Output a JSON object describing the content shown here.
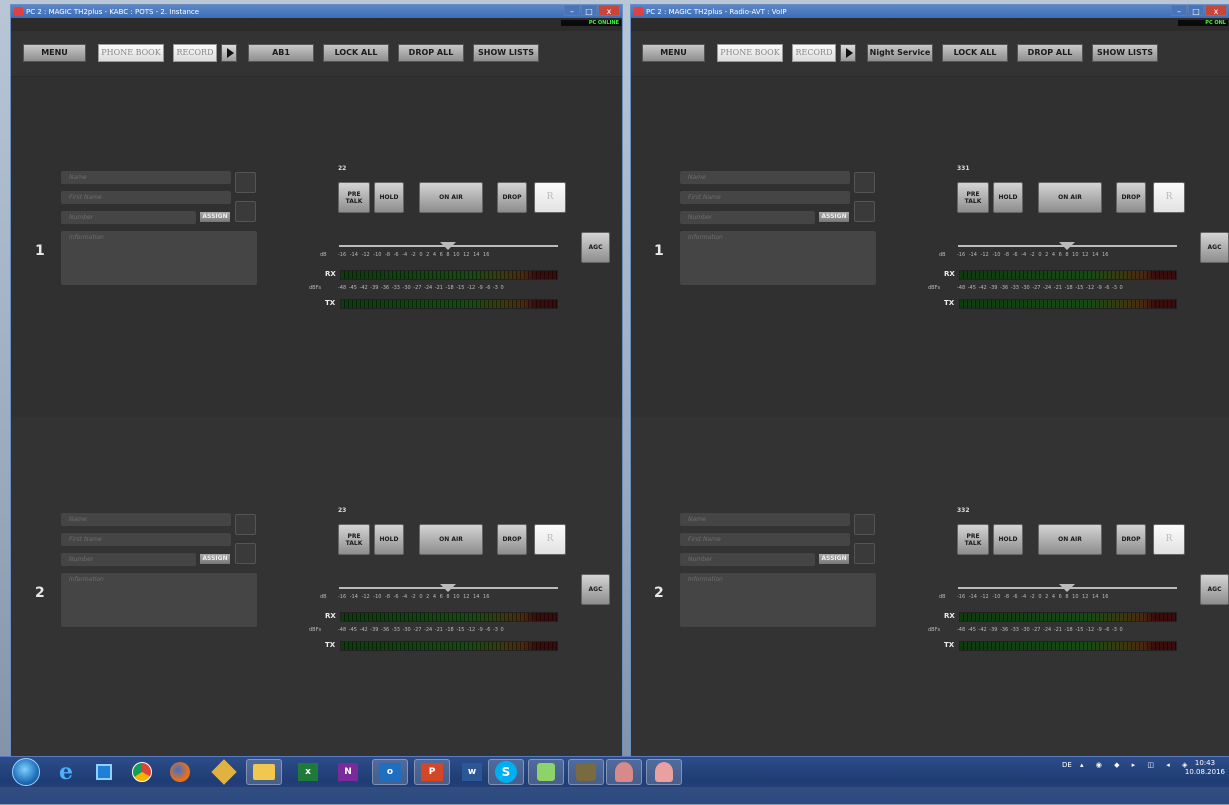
{
  "windows": [
    {
      "title": "PC 2 : MAGIC TH2plus - KABC : POTS - 2. Instance",
      "online": "PC ONLINE",
      "toolbar": {
        "menu": "MENU",
        "phonebook": "PHONE BOOK",
        "record": "RECORD",
        "service": "AB1",
        "lock_all": "LOCK ALL",
        "drop_all": "DROP ALL",
        "show_lists": "SHOW LISTS"
      },
      "lines": [
        {
          "index": "1",
          "channel": "22"
        },
        {
          "index": "2",
          "channel": "23"
        }
      ]
    },
    {
      "title": "PC 2 : MAGIC TH2plus - Radio-AVT : VoIP",
      "online": "PC ONL",
      "toolbar": {
        "menu": "MENU",
        "phonebook": "PHONE BOOK",
        "record": "RECORD",
        "service": "Night Service",
        "lock_all": "LOCK ALL",
        "drop_all": "DROP ALL",
        "show_lists": "SHOW LISTS"
      },
      "lines": [
        {
          "index": "1",
          "channel": "331"
        },
        {
          "index": "2",
          "channel": "332"
        }
      ]
    }
  ],
  "fields": {
    "name": "Name",
    "first_name": "First Name",
    "number": "Number",
    "assign": "ASSIGN",
    "information": "Information"
  },
  "buttons": {
    "pre": "PRE",
    "talk": "TALK",
    "hold": "HOLD",
    "on_air": "ON AIR",
    "drop": "DROP",
    "r": "R",
    "agc": "AGC"
  },
  "meter": {
    "db_label": "dB",
    "db_ticks": "-16 -14 -12 -10 -8 -6 -4 -2 0 2 4 6 8 10 12 14 16",
    "dbfs_label": "dBFs",
    "dbfs_ticks": "-48 -45 -42 -39 -36 -33 -30 -27 -24 -21 -18 -15 -12 -9 -6 -3 0",
    "rx": "RX",
    "tx": "TX",
    "gain_db": 0
  },
  "window_buttons": {
    "minimize": "–",
    "maximize": "□",
    "close": "x"
  },
  "taskbar": {
    "lang": "DE",
    "time": "10:43",
    "date": "10.08.2016",
    "apps": [
      "windows-start",
      "internet-explorer",
      "outlook-mail",
      "chrome",
      "firefox",
      "puzzle-app",
      "file-explorer",
      "excel",
      "onenote",
      "outlook",
      "powerpoint",
      "word",
      "skype",
      "notepad-plus",
      "photo-app",
      "magic-app-1",
      "magic-app-2"
    ]
  }
}
